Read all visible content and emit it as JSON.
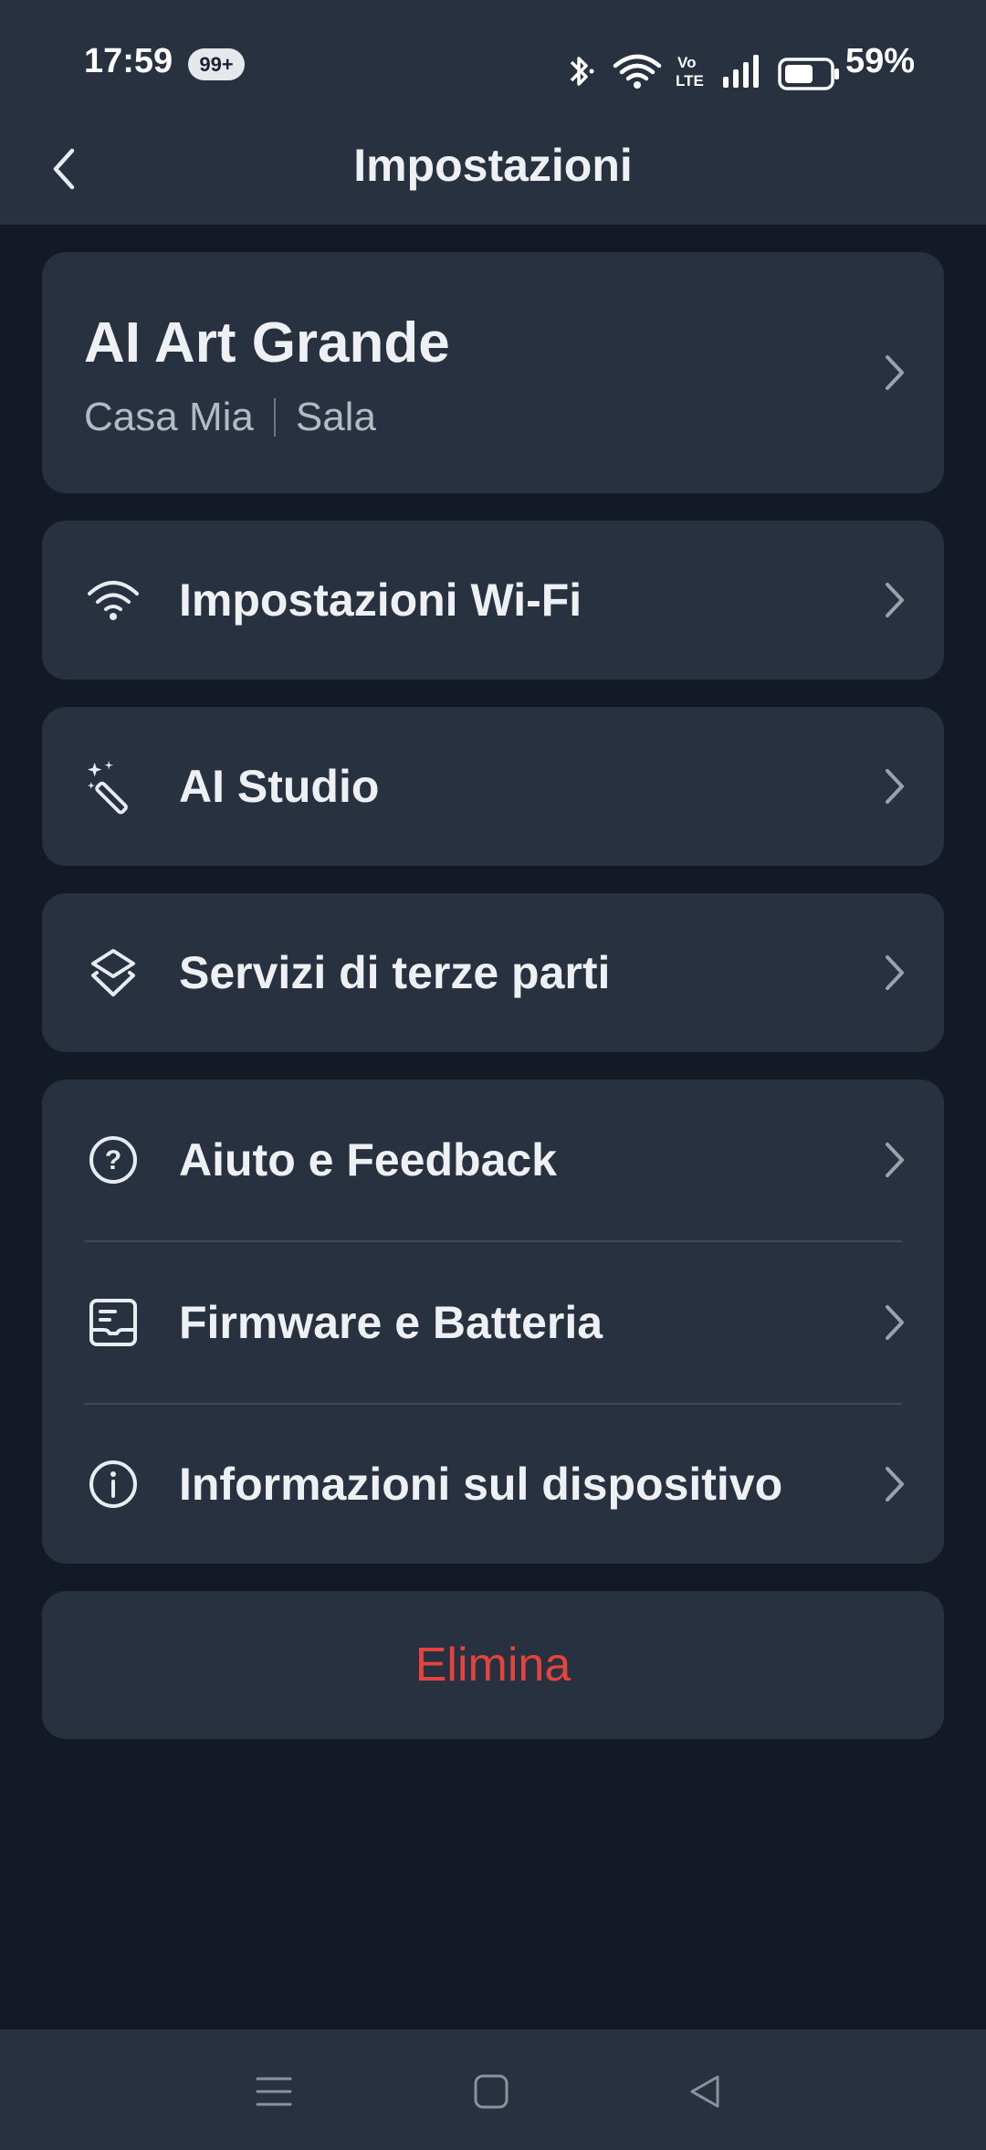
{
  "status_bar": {
    "time": "17:59",
    "notification_badge": "99+",
    "battery": "59%"
  },
  "header": {
    "title": "Impostazioni"
  },
  "device": {
    "name": "AI Art Grande",
    "home": "Casa Mia",
    "room": "Sala"
  },
  "menu": {
    "wifi": "Impostazioni Wi-Fi",
    "ai_studio": "AI Studio",
    "third_party": "Servizi di terze parti",
    "help": "Aiuto e Feedback",
    "firmware": "Firmware e Batteria",
    "info": "Informazioni  sul dispositivo"
  },
  "delete_label": "Elimina",
  "colors": {
    "background": "#131a25",
    "card": "#27313f",
    "danger": "#e5433f"
  }
}
